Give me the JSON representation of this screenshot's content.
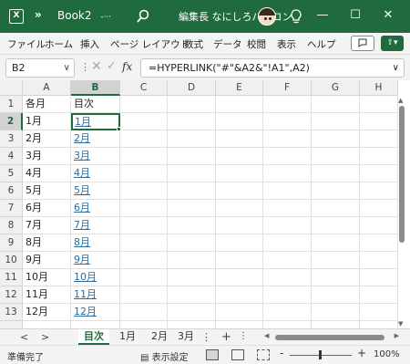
{
  "titlebar": {
    "app_icon": "excel-logo-icon",
    "more_label": "»",
    "doc_title": "Book2",
    "doc_dash": "-···",
    "search_icon": "search-icon",
    "account_name": "編集長 なにしろパソコン",
    "lightbulb_icon": "lightbulb-icon",
    "minimize": "—",
    "maximize": "☐",
    "close": "✕",
    "accent": "#1f6b3e"
  },
  "menu": {
    "tabs": [
      "ファイル",
      "ホーム",
      "挿入",
      "ページ レイアウト",
      "数式",
      "データ",
      "校閲",
      "表示",
      "ヘルプ"
    ],
    "comment_icon": "comment-icon",
    "share_icon": "share-icon"
  },
  "formula_bar": {
    "name_box": "B2",
    "formula": "=HYPERLINK(\"#\"&A2&\"!A1\",A2)",
    "cancel_icon": "✕",
    "enter_icon": "✓",
    "fx_label": "fx"
  },
  "grid": {
    "columns": [
      "A",
      "B",
      "C",
      "D",
      "E",
      "F",
      "G",
      "H"
    ],
    "rows": [
      "1",
      "2",
      "3",
      "4",
      "5",
      "6",
      "7",
      "8",
      "9",
      "10",
      "11",
      "12",
      "13"
    ],
    "col_a": [
      "各月",
      "1月",
      "2月",
      "3月",
      "4月",
      "5月",
      "6月",
      "7月",
      "8月",
      "9月",
      "10月",
      "11月",
      "12月",
      ""
    ],
    "col_b": [
      "目次",
      "1月",
      "2月",
      "3月",
      "4月",
      "5月",
      "6月",
      "7月",
      "8月",
      "9月",
      "10月",
      "11月",
      "12月",
      ""
    ],
    "active_cell": "B2"
  },
  "sheets": {
    "tabs": [
      "目次",
      "1月",
      "2月",
      "3月"
    ],
    "active": "目次",
    "prev": "<",
    "next": ">",
    "add": "+",
    "more": "⋮"
  },
  "status": {
    "ready": "準備完了",
    "display_settings": "表示設定",
    "zoom_minus": "-",
    "zoom_plus": "+",
    "zoom": "100%"
  }
}
